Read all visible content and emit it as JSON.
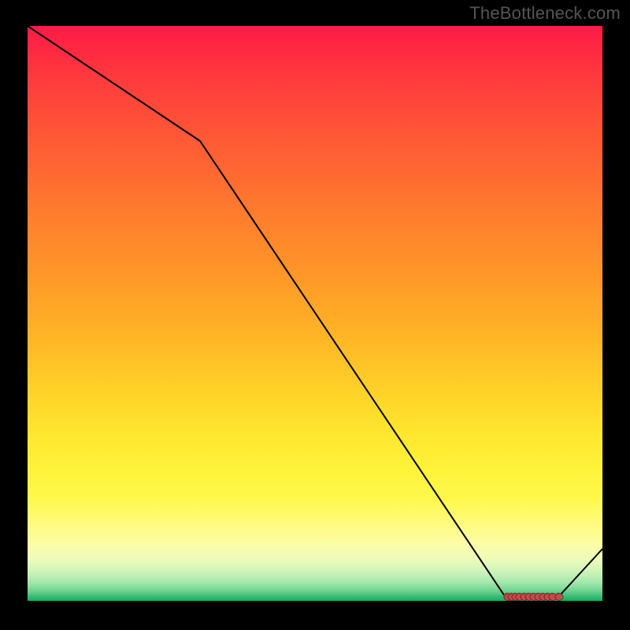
{
  "watermark": "TheBottleneck.com",
  "chart_data": {
    "type": "line",
    "title": "",
    "xlabel": "",
    "ylabel": "",
    "xlim": [
      0,
      100
    ],
    "ylim": [
      0,
      100
    ],
    "x": [
      0,
      30,
      83,
      92.5,
      100
    ],
    "values": [
      100,
      80,
      0.8,
      0.8,
      9
    ],
    "annotations": {
      "flat_minimum_segment": {
        "x_range": [
          83,
          92.5
        ],
        "y": 0.8
      },
      "marker_cluster_x": [
        83.4,
        84.1,
        84.8,
        85.5,
        86.3,
        87.1,
        87.9,
        88.7,
        89.5,
        90.4,
        91.3,
        92.3
      ]
    },
    "legend": []
  }
}
